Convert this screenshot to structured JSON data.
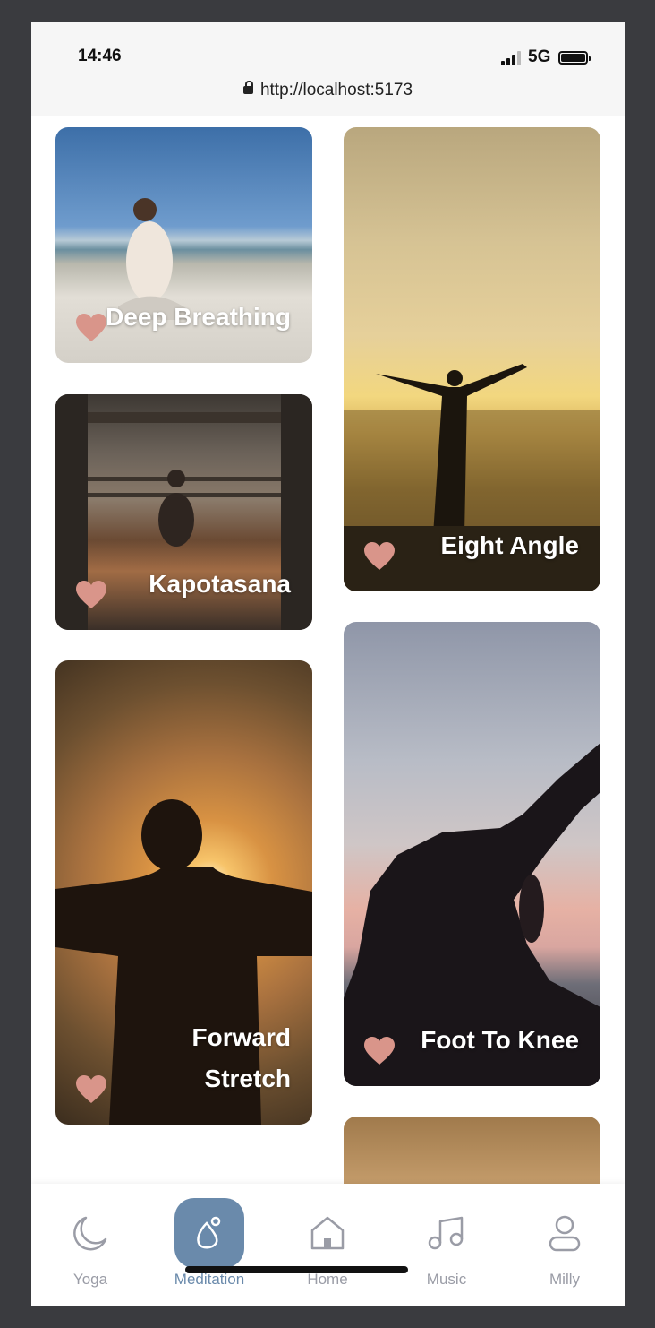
{
  "status_bar": {
    "time": "14:46",
    "network": "5G",
    "url": "http://localhost:5173"
  },
  "cards": [
    {
      "title": "Deep Breathing"
    },
    {
      "title": "Kapotasana"
    },
    {
      "title": "Forward\nStretch"
    },
    {
      "title": "Eight Angle"
    },
    {
      "title": "Foot To Knee"
    }
  ],
  "tabbar": {
    "items": [
      {
        "label": "Yoga",
        "icon": "moon-icon"
      },
      {
        "label": "Meditation",
        "icon": "meditation-icon"
      },
      {
        "label": "Home",
        "icon": "home-icon"
      },
      {
        "label": "Music",
        "icon": "music-note-icon"
      },
      {
        "label": "Milly",
        "icon": "user-icon"
      }
    ],
    "active": "Meditation"
  },
  "colors": {
    "accent": "#6a8aab",
    "heart": "#d9958a",
    "tab_inactive": "#9a9ca6"
  }
}
